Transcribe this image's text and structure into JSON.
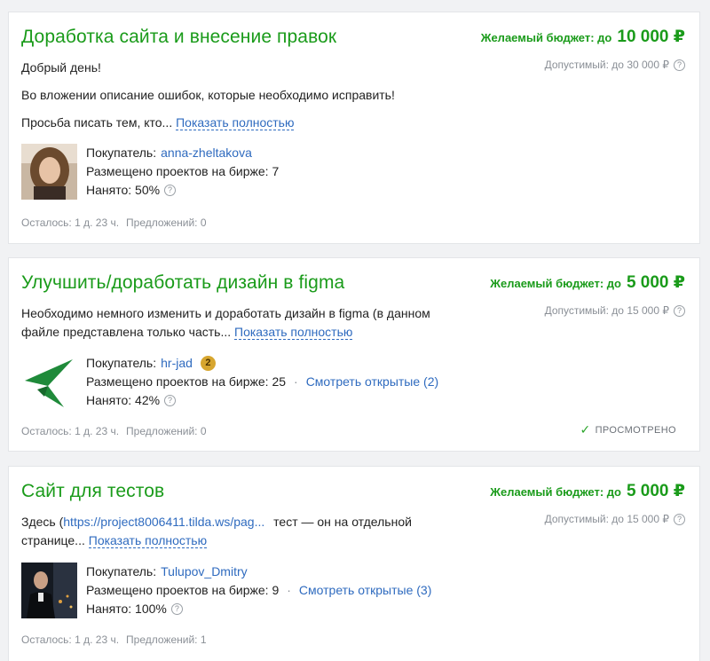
{
  "projects": [
    {
      "title": "Доработка сайта и внесение правок",
      "budget_label": "Желаемый бюджет: до",
      "budget_amount": "10 000 ₽",
      "allowed": "Допустимый: до 30 000 ₽",
      "desc_line1": "Добрый день!",
      "desc_line2": "Во вложении описание ошибок, которые необходимо исправить!",
      "desc_line3": "Просьба писать тем, кто...",
      "show_more": "Показать полностью",
      "buyer_label": "Покупатель:",
      "buyer_name": "anna-zheltakova",
      "placed": "Размещено проектов на бирже: 7",
      "hired": "Нанято: 50%",
      "remaining": "Осталось: 1 д. 23 ч.",
      "offers": "Предложений: 0"
    },
    {
      "title": "Улучшить/доработать дизайн в figma",
      "budget_label": "Желаемый бюджет: до",
      "budget_amount": "5 000 ₽",
      "allowed": "Допустимый: до 15 000 ₽",
      "desc_line1": "Необходимо немного изменить и доработать дизайн в figma (в данном",
      "desc_line2": "файле представлена только часть...",
      "show_more": "Показать полностью",
      "buyer_label": "Покупатель:",
      "buyer_name": "hr-jad",
      "buyer_badge": "2",
      "placed": "Размещено проектов на бирже: 25",
      "open_link": "Смотреть открытые (2)",
      "hired": "Нанято: 42%",
      "remaining": "Осталось: 1 д. 23 ч.",
      "offers": "Предложений: 0",
      "viewed": "ПРОСМОТРЕНО"
    },
    {
      "title": "Сайт для тестов",
      "budget_label": "Желаемый бюджет: до",
      "budget_amount": "5 000 ₽",
      "allowed": "Допустимый: до 15 000 ₽",
      "desc_prefix": "Здесь (",
      "desc_link": "https://project8006411.tilda.ws/pag...",
      "desc_suffix": "тест — он на отдельной",
      "desc_line2": "странице...",
      "show_more": "Показать полностью",
      "buyer_label": "Покупатель:",
      "buyer_name": "Tulupov_Dmitry",
      "placed": "Размещено проектов на бирже: 9",
      "open_link": "Смотреть открытые (3)",
      "hired": "Нанято: 100%",
      "remaining": "Осталось: 1 д. 23 ч.",
      "offers": "Предложений: 1"
    }
  ],
  "help_icon": "?",
  "colors": {
    "accent_green": "#1a9b1a",
    "link_blue": "#2f6bbf",
    "muted": "#8a8f96"
  }
}
